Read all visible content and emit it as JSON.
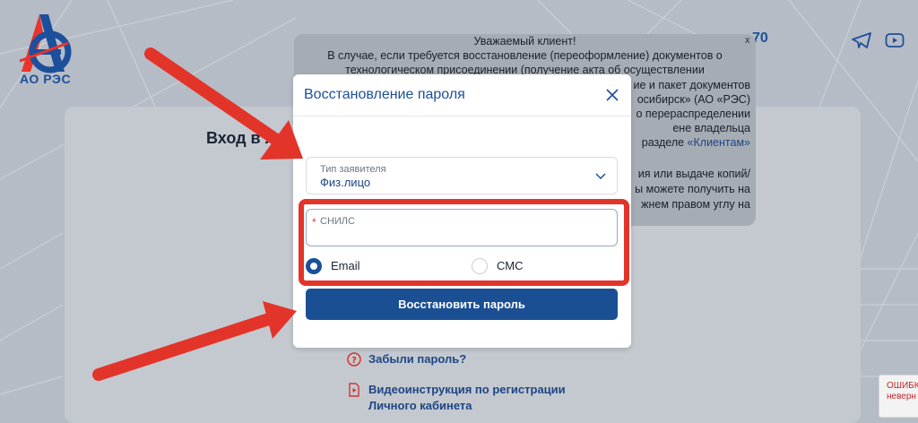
{
  "header": {
    "logo_text": "АО РЭС",
    "phone_fragment": "70",
    "icons": [
      "telegram-icon",
      "youtube-icon"
    ]
  },
  "login_panel": {
    "title": "Вход в л",
    "links": [
      {
        "icon": "question-icon",
        "label": "Забыли пароль?"
      },
      {
        "icon": "video-doc-icon",
        "label_line1": "Видеоинструкция по регистрации",
        "label_line2": "Личного кабинета"
      }
    ]
  },
  "notice": {
    "heading": "Уважаемый клиент!",
    "line1": "В случае, если требуется восстановление (переоформление) документов о",
    "line2": "технологическом присоединении (получение акта об осуществлении",
    "right_lines": [
      "ие и пакет документов",
      "осибирск» (АО «РЭС)",
      "о перераспределении",
      "ене владельца",
      "разделе "
    ],
    "link": "«Клиентам»",
    "right_lines_2": [
      "ия или выдаче копий/",
      "ы можете получить на",
      "жнем правом углу на"
    ],
    "close": "x"
  },
  "modal": {
    "title": "Восстановление пароля",
    "type_field": {
      "label": "Тип заявителя",
      "value": "Физ.лицо"
    },
    "snils_field": {
      "required_mark": "*",
      "placeholder": "СНИЛС"
    },
    "radios": [
      {
        "label": "Email",
        "selected": true
      },
      {
        "label": "СМС",
        "selected": false
      }
    ],
    "submit_label": "Восстановить пароль"
  },
  "recaptcha": {
    "line1": "ОШИБК",
    "line2": "неверн"
  },
  "colors": {
    "brand_blue": "#1b4f94",
    "annotation_red": "#e3342a",
    "required_red": "#e23b2e"
  }
}
